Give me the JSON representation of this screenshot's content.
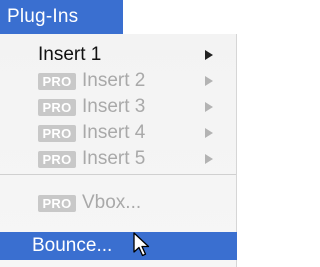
{
  "menu": {
    "title": "Plug-Ins",
    "badge_label": "PRO",
    "items": [
      {
        "label": "Insert 1",
        "enabled": true,
        "has_submenu": true
      },
      {
        "label": "Insert 2",
        "enabled": false,
        "pro": true,
        "has_submenu": true
      },
      {
        "label": "Insert 3",
        "enabled": false,
        "pro": true,
        "has_submenu": true
      },
      {
        "label": "Insert 4",
        "enabled": false,
        "pro": true,
        "has_submenu": true
      },
      {
        "label": "Insert 5",
        "enabled": false,
        "pro": true,
        "has_submenu": true
      },
      {
        "label": "Vbox...",
        "enabled": false,
        "pro": true,
        "has_submenu": false
      },
      {
        "label": "Bounce...",
        "enabled": true,
        "highlighted": true,
        "has_submenu": false
      }
    ]
  },
  "icons": {
    "submenu": "chevron-right-icon",
    "pointer": "mouse-pointer-icon"
  },
  "colors": {
    "highlight": "#3a6fd0",
    "menu_background": "#f3f3f3",
    "disabled_text": "#a9a9a9",
    "badge_background": "#c8c8c8"
  }
}
